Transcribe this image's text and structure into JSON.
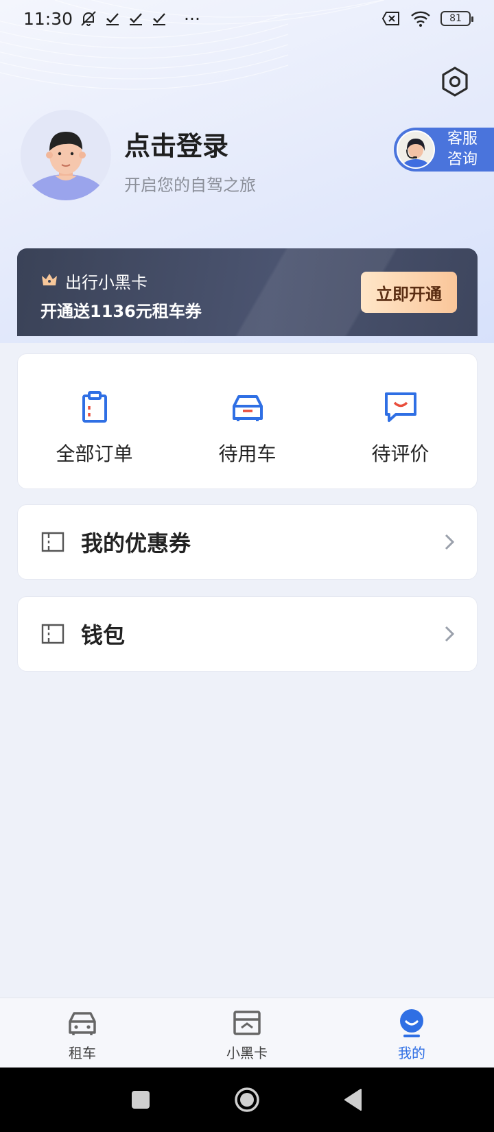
{
  "status_bar": {
    "time": "11:30",
    "more": "···",
    "battery": "81"
  },
  "profile": {
    "login_title": "点击登录",
    "login_subtitle": "开启您的自驾之旅",
    "customer_service_line1": "客服",
    "customer_service_line2": "咨询"
  },
  "vip_card": {
    "title": "出行小黑卡",
    "description": "开通送1136元租车券",
    "button_label": "立即开通"
  },
  "orders": [
    {
      "label": "全部订单",
      "icon": "clipboard-icon"
    },
    {
      "label": "待用车",
      "icon": "car-icon"
    },
    {
      "label": "待评价",
      "icon": "smile-chat-icon"
    }
  ],
  "menu": [
    {
      "label": "我的优惠券",
      "icon": "coupon-icon"
    },
    {
      "label": "钱包",
      "icon": "wallet-icon"
    }
  ],
  "tabs": [
    {
      "label": "租车",
      "icon": "car-tab-icon",
      "active": false
    },
    {
      "label": "小黑卡",
      "icon": "card-tab-icon",
      "active": false
    },
    {
      "label": "我的",
      "icon": "profile-tab-icon",
      "active": true
    }
  ],
  "colors": {
    "accent": "#2f6fe4",
    "vip_bg": "#3a4257",
    "vip_button": "#fac69a",
    "cs_button": "#4a74dc"
  }
}
